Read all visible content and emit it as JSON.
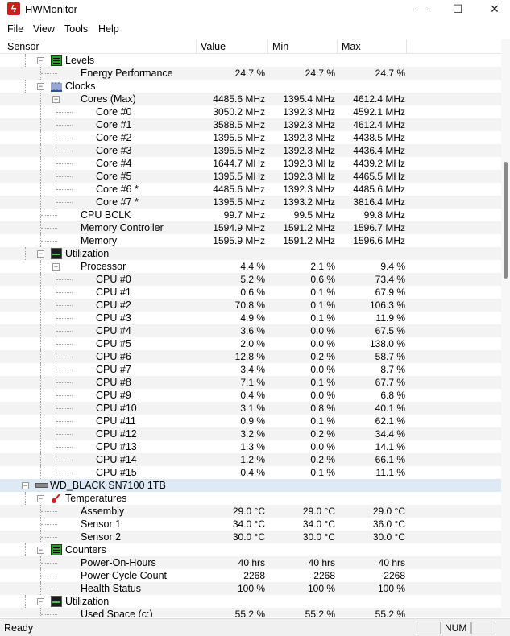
{
  "window": {
    "title": "HWMonitor",
    "app_icon": "lightning-bolt-icon"
  },
  "menu": [
    "File",
    "View",
    "Tools",
    "Help"
  ],
  "columns": {
    "sensor": "Sensor",
    "value": "Value",
    "min": "Min",
    "max": "Max"
  },
  "rows": [
    {
      "label": "Levels",
      "level": 2,
      "kind": "group",
      "icon": "levels-icon"
    },
    {
      "label": "Energy Performance",
      "level": 3,
      "value": "24.7 %",
      "min": "24.7 %",
      "max": "24.7 %"
    },
    {
      "label": "Clocks",
      "level": 2,
      "kind": "group",
      "icon": "clocks-icon"
    },
    {
      "label": "Cores (Max)",
      "level": 3,
      "kind": "subgroup",
      "value": "4485.6 MHz",
      "min": "1395.4 MHz",
      "max": "4612.4 MHz"
    },
    {
      "label": "Core #0",
      "level": 4,
      "value": "3050.2 MHz",
      "min": "1392.3 MHz",
      "max": "4592.1 MHz"
    },
    {
      "label": "Core #1",
      "level": 4,
      "value": "3588.5 MHz",
      "min": "1392.3 MHz",
      "max": "4612.4 MHz"
    },
    {
      "label": "Core #2",
      "level": 4,
      "value": "1395.5 MHz",
      "min": "1392.3 MHz",
      "max": "4438.5 MHz"
    },
    {
      "label": "Core #3",
      "level": 4,
      "value": "1395.5 MHz",
      "min": "1392.3 MHz",
      "max": "4436.4 MHz"
    },
    {
      "label": "Core #4",
      "level": 4,
      "value": "1644.7 MHz",
      "min": "1392.3 MHz",
      "max": "4439.2 MHz"
    },
    {
      "label": "Core #5",
      "level": 4,
      "value": "1395.5 MHz",
      "min": "1392.3 MHz",
      "max": "4465.5 MHz"
    },
    {
      "label": "Core #6 *",
      "level": 4,
      "value": "4485.6 MHz",
      "min": "1392.3 MHz",
      "max": "4485.6 MHz"
    },
    {
      "label": "Core #7 *",
      "level": 4,
      "value": "1395.5 MHz",
      "min": "1393.2 MHz",
      "max": "3816.4 MHz"
    },
    {
      "label": "CPU BCLK",
      "level": 3,
      "value": "99.7 MHz",
      "min": "99.5 MHz",
      "max": "99.8 MHz"
    },
    {
      "label": "Memory Controller",
      "level": 3,
      "value": "1594.9 MHz",
      "min": "1591.2 MHz",
      "max": "1596.7 MHz"
    },
    {
      "label": "Memory",
      "level": 3,
      "value": "1595.9 MHz",
      "min": "1591.2 MHz",
      "max": "1596.6 MHz"
    },
    {
      "label": "Utilization",
      "level": 2,
      "kind": "group",
      "icon": "utilization-icon"
    },
    {
      "label": "Processor",
      "level": 3,
      "kind": "subgroup",
      "value": "4.4 %",
      "min": "2.1 %",
      "max": "9.4 %"
    },
    {
      "label": "CPU #0",
      "level": 4,
      "value": "5.2 %",
      "min": "0.6 %",
      "max": "73.4 %"
    },
    {
      "label": "CPU #1",
      "level": 4,
      "value": "0.6 %",
      "min": "0.1 %",
      "max": "67.9 %"
    },
    {
      "label": "CPU #2",
      "level": 4,
      "value": "70.8 %",
      "min": "0.1 %",
      "max": "106.3 %",
      "selected": true
    },
    {
      "label": "CPU #3",
      "level": 4,
      "value": "4.9 %",
      "min": "0.1 %",
      "max": "11.9 %"
    },
    {
      "label": "CPU #4",
      "level": 4,
      "value": "3.6 %",
      "min": "0.0 %",
      "max": "67.5 %"
    },
    {
      "label": "CPU #5",
      "level": 4,
      "value": "2.0 %",
      "min": "0.0 %",
      "max": "138.0 %"
    },
    {
      "label": "CPU #6",
      "level": 4,
      "value": "12.8 %",
      "min": "0.2 %",
      "max": "58.7 %"
    },
    {
      "label": "CPU #7",
      "level": 4,
      "value": "3.4 %",
      "min": "0.0 %",
      "max": "8.7 %"
    },
    {
      "label": "CPU #8",
      "level": 4,
      "value": "7.1 %",
      "min": "0.1 %",
      "max": "67.7 %"
    },
    {
      "label": "CPU #9",
      "level": 4,
      "value": "0.4 %",
      "min": "0.0 %",
      "max": "6.8 %"
    },
    {
      "label": "CPU #10",
      "level": 4,
      "value": "3.1 %",
      "min": "0.8 %",
      "max": "40.1 %"
    },
    {
      "label": "CPU #11",
      "level": 4,
      "value": "0.9 %",
      "min": "0.1 %",
      "max": "62.1 %"
    },
    {
      "label": "CPU #12",
      "level": 4,
      "value": "3.2 %",
      "min": "0.2 %",
      "max": "34.4 %"
    },
    {
      "label": "CPU #13",
      "level": 4,
      "value": "1.3 %",
      "min": "0.0 %",
      "max": "14.1 %"
    },
    {
      "label": "CPU #14",
      "level": 4,
      "value": "1.2 %",
      "min": "0.2 %",
      "max": "66.1 %"
    },
    {
      "label": "CPU #15",
      "level": 4,
      "value": "0.4 %",
      "min": "0.1 %",
      "max": "11.1 %"
    },
    {
      "label": "WD_BLACK SN7100 1TB",
      "level": 1,
      "kind": "device",
      "icon": "drive-icon"
    },
    {
      "label": "Temperatures",
      "level": 2,
      "kind": "group",
      "icon": "thermometer-icon"
    },
    {
      "label": "Assembly",
      "level": 3,
      "value": "29.0 °C",
      "min": "29.0 °C",
      "max": "29.0 °C"
    },
    {
      "label": "Sensor 1",
      "level": 3,
      "value": "34.0 °C",
      "min": "34.0 °C",
      "max": "36.0 °C"
    },
    {
      "label": "Sensor 2",
      "level": 3,
      "value": "30.0 °C",
      "min": "30.0 °C",
      "max": "30.0 °C"
    },
    {
      "label": "Counters",
      "level": 2,
      "kind": "group",
      "icon": "counters-icon"
    },
    {
      "label": "Power-On-Hours",
      "level": 3,
      "value": "40 hrs",
      "min": "40 hrs",
      "max": "40 hrs"
    },
    {
      "label": "Power Cycle Count",
      "level": 3,
      "value": "2268",
      "min": "2268",
      "max": "2268"
    },
    {
      "label": "Health Status",
      "level": 3,
      "value": "100 %",
      "min": "100 %",
      "max": "100 %"
    },
    {
      "label": "Utilization",
      "level": 2,
      "kind": "group",
      "icon": "utilization-icon"
    },
    {
      "label": "Used Space (c:)",
      "level": 3,
      "value": "55.2 %",
      "min": "55.2 %",
      "max": "55.2 %"
    }
  ],
  "status": {
    "text": "Ready",
    "cells": [
      "",
      "NUM",
      ""
    ]
  }
}
